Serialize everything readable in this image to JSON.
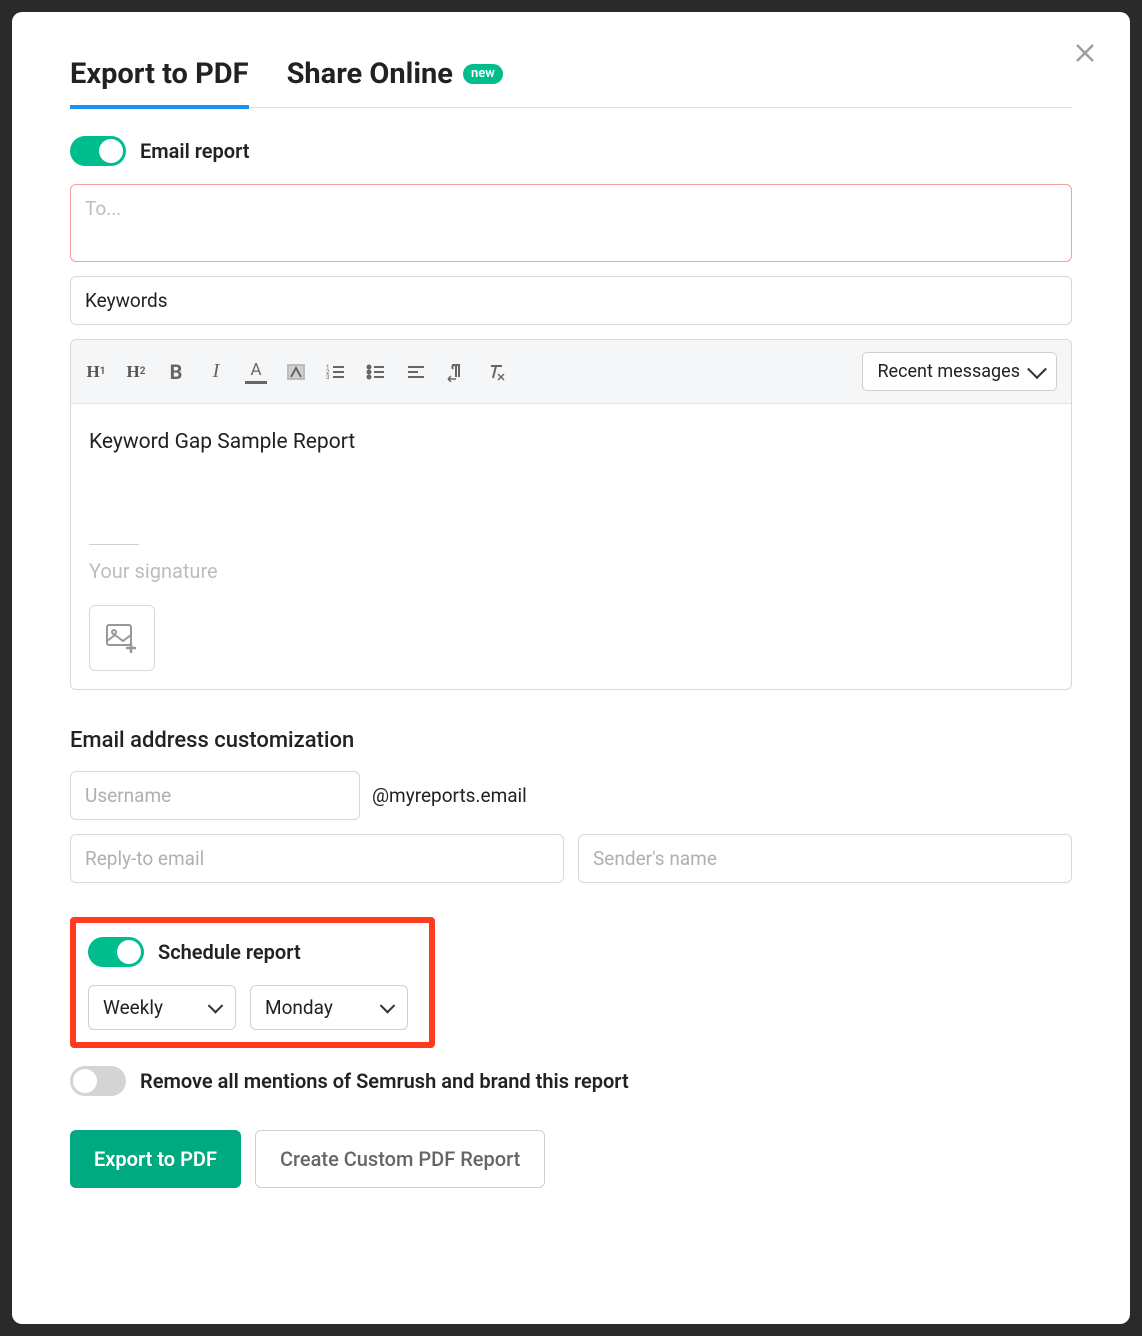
{
  "tabs": {
    "export_pdf": "Export to PDF",
    "share_online": "Share Online",
    "new_badge": "new"
  },
  "email_report": {
    "toggle_label": "Email report",
    "to_placeholder": "To...",
    "subject_value": "Keywords",
    "recent_messages": "Recent messages",
    "body_text": "Keyword Gap Sample Report",
    "signature_placeholder": "Your signature"
  },
  "email_customization": {
    "title": "Email address customization",
    "username_placeholder": "Username",
    "domain": "@myreports.email",
    "reply_to_placeholder": "Reply-to email",
    "sender_name_placeholder": "Sender's name"
  },
  "schedule": {
    "toggle_label": "Schedule report",
    "frequency": "Weekly",
    "day": "Monday"
  },
  "branding": {
    "toggle_label": "Remove all mentions of Semrush and brand this report"
  },
  "actions": {
    "export": "Export to PDF",
    "custom": "Create Custom PDF Report"
  }
}
